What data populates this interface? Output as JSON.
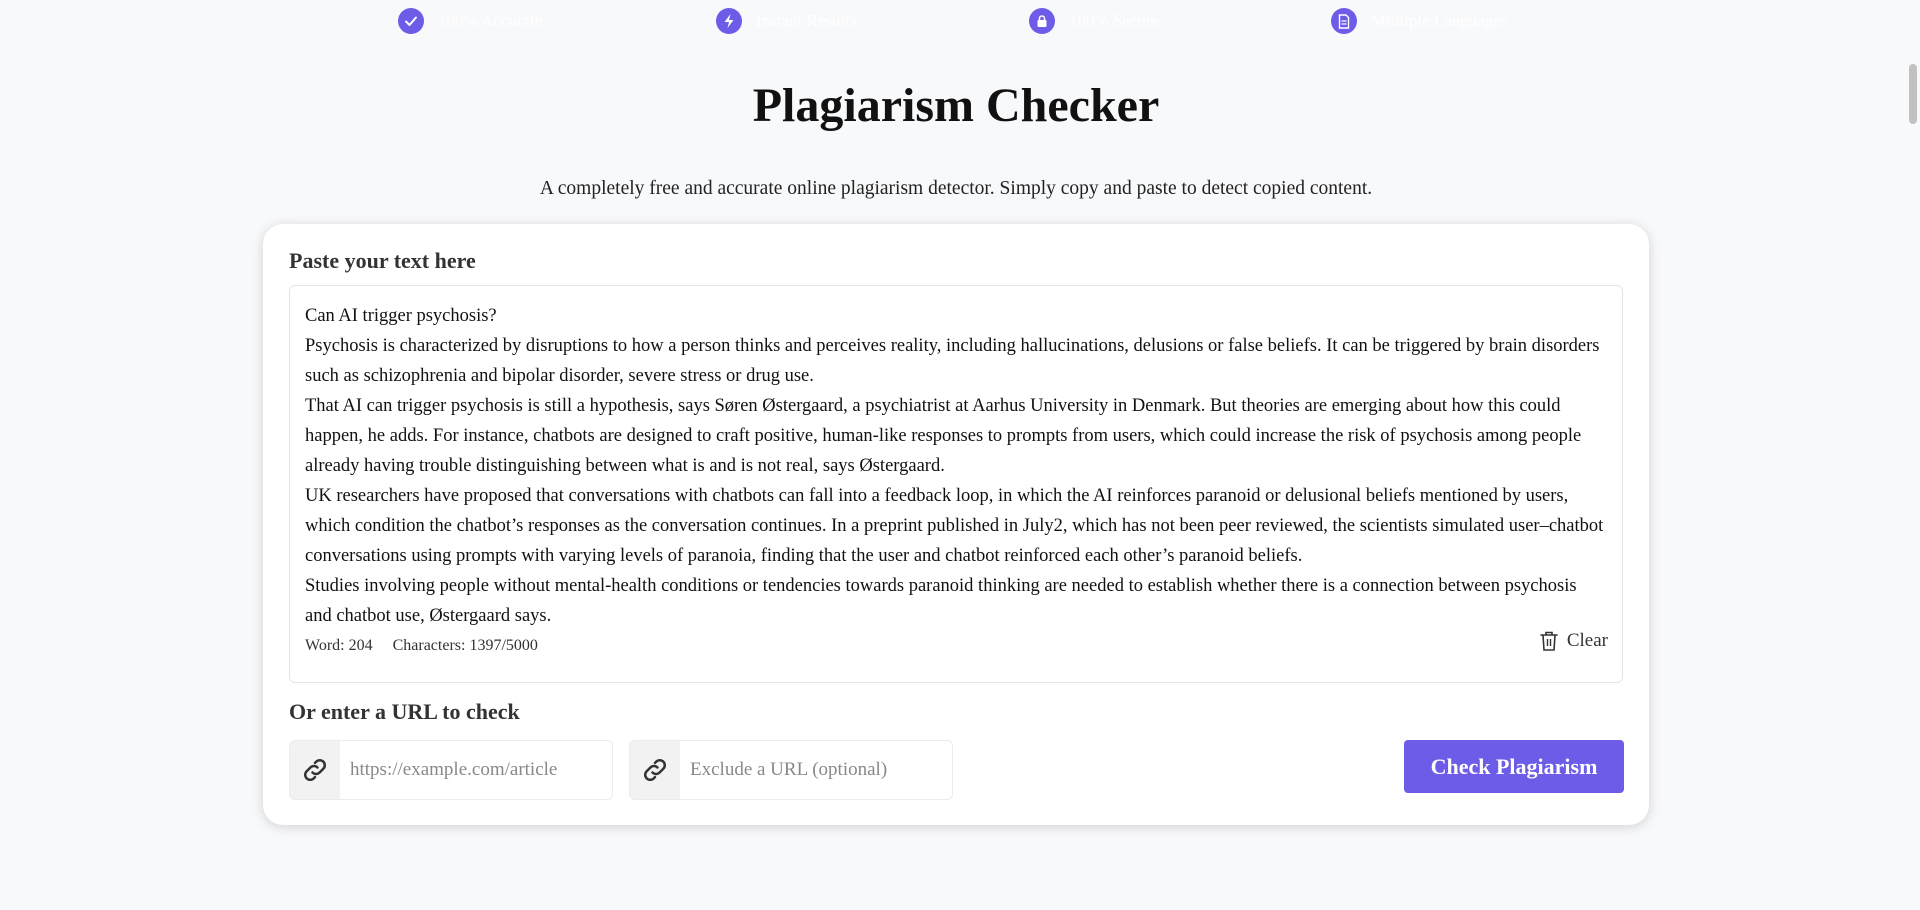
{
  "features": [
    {
      "icon": "check-icon",
      "label": "100% Accurate"
    },
    {
      "icon": "bolt-icon",
      "label": "Instant Results"
    },
    {
      "icon": "lock-icon",
      "label": "100% Secure"
    },
    {
      "icon": "document-icon",
      "label": "Multiple Languages"
    }
  ],
  "page": {
    "title": "Plagiarism Checker",
    "subtitle": "A completely free and accurate online plagiarism detector. Simply copy and paste to detect copied content."
  },
  "editor": {
    "label": "Paste your text here",
    "paragraphs": [
      "Can AI trigger psychosis?",
      "Psychosis is characterized by disruptions to how a person thinks and perceives reality, including hallucinations, delusions or false beliefs. It can be triggered by brain disorders such as schizophrenia and bipolar disorder, severe stress or drug use.",
      "That AI can trigger psychosis is still a hypothesis, says Søren Østergaard, a psychiatrist at Aarhus University in Denmark. But theories are emerging about how this could happen, he adds. For instance, chatbots are designed to craft positive, human-like responses to prompts from users, which could increase the risk of psychosis among people already having trouble distinguishing between what is and is not real, says Østergaard.",
      "UK researchers have proposed that conversations with chatbots can fall into a feedback loop, in which the AI reinforces paranoid or delusional beliefs mentioned by users, which condition the chatbot’s responses as the conversation continues. In a preprint published in July2, which has not been peer reviewed, the scientists simulated user–chatbot conversations using prompts with varying levels of paranoia, finding that the user and chatbot reinforced each other’s paranoid beliefs.",
      "Studies involving people without mental-health conditions or tendencies towards paranoid thinking are needed to establish whether there is a connection between psychosis and chatbot use, Østergaard says."
    ],
    "word_count": "Word: 204",
    "char_count": "Characters: 1397/5000",
    "clear_label": "Clear"
  },
  "url": {
    "label": "Or enter a URL to check",
    "check_placeholder": "https://example.com/article",
    "exclude_placeholder": "Exclude a URL (optional)",
    "check_value": "",
    "exclude_value": ""
  },
  "actions": {
    "check_label": "Check Plagiarism"
  },
  "colors": {
    "accent": "#6c5ce7",
    "background": "#f8f9fb"
  }
}
